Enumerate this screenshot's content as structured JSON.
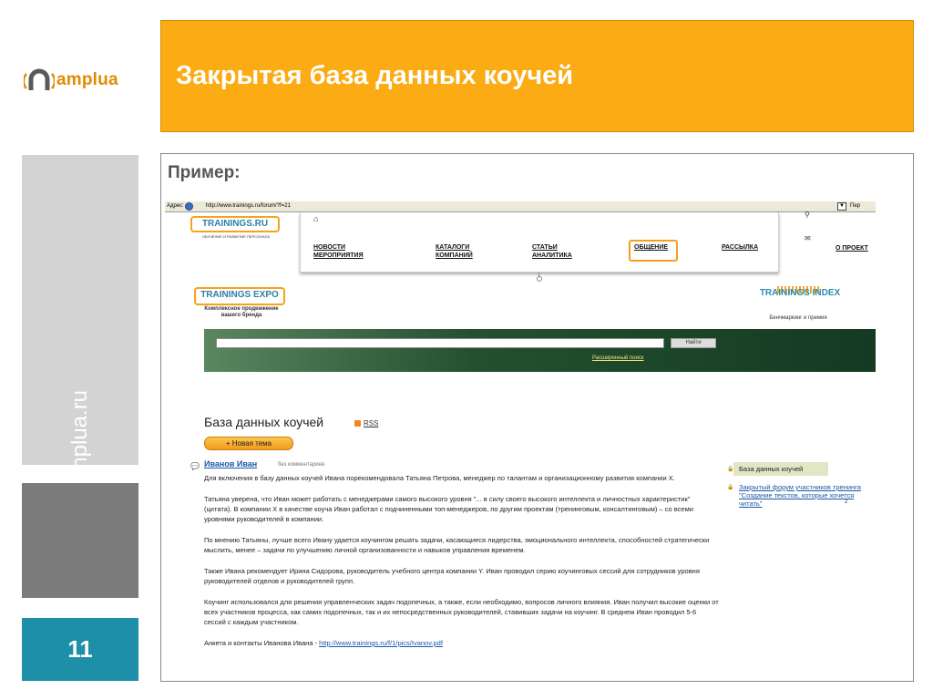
{
  "logo": {
    "text": "amplua"
  },
  "header": {
    "title": "Закрытая база данных коучей"
  },
  "sidebar": {
    "url_text": "www.amplua.ru",
    "page_number": "11"
  },
  "content": {
    "example_label": "Пример:"
  },
  "browser": {
    "address_label": "Адрес:",
    "address_url": "http://www.trainings.ru/forum/?f=21",
    "go_label": "Пер",
    "site_logo": "TRAININGS.RU",
    "site_logo_sub": "ОБУЧЕНИЕ И РАЗВИТИЕ ПЕРСОНАЛА",
    "nav": [
      {
        "line1": "НОВОСТИ",
        "line2": "МЕРОПРИЯТИЯ"
      },
      {
        "line1": "КАТАЛОГИ",
        "line2": "КОМПАНИЙ"
      },
      {
        "line1": "СТАТЬИ",
        "line2": "АНАЛИТИКА"
      },
      {
        "line1": "ОБЩЕНИЕ",
        "line2": ""
      },
      {
        "line1": "РАССЫЛКА",
        "line2": ""
      }
    ],
    "nav_extra": "О ПРОЕКТ",
    "expo_logo": "TRAININGS EXPO",
    "expo_sub_1": "Комплексное продвижение",
    "expo_sub_2": "вашего бренда",
    "index_logo": "TRAININGS INDEX",
    "index_sub": "Бенчмаркинг и премия",
    "search_button": "Найти",
    "advanced_search": "Расширенный поиск",
    "db_title": "База данных коучей",
    "rss": "RSS",
    "new_topic": "+ Новая тема",
    "post": {
      "author": "Иванов Иван",
      "meta": "без комментариев",
      "p1": "Для включения в базу данных коучей Ивана порекомендовала Татьяна Петрова, менеджер по талантам и организационному развития компании X.",
      "p2": "Татьяна уверена, что Иван может работать с менеджерами самого высокого уровня \"... в силу своего высокого интеллекта и личностных характеристик\" (цитата). В компании X в качестве коуча Иван работал с подчиненными топ-менеджеров, по другим проектам (тренинговым, консалтинговым) – со всеми уровнями руководителей в компании.",
      "p3": "По мнению Татьяны, лучше всего Ивану удается коучингом решать задачи, касающиеся лидерства, эмоционального интеллекта, способностей стратегически мыслить, менее – задачи по улучшению личной организованности и навыков управления временем.",
      "p4": "Также Ивана рекомендует Ирина Сидорова, руководитель учебного центра компании Y. Иван проводил серию коучинговых сессий для сотрудников уровня руководителей отделов и руководителей групп.",
      "p5": "Коучинг использовался для решения управленческих задач подопечных, а также, если необходимо, вопросов личного влияния. Иван получил высокие оценки от всех участников процесса, как самих подопечных, так и их непосредственных руководителей, ставивших задачи на коучинг. В среднем Иван проводил 5-6 сессий с каждым участником.",
      "p6_prefix": "Анкета и контакты Иванова Ивана - ",
      "p6_link": "http://www.trainings.ru/f/1/pics/Ivanov.pdf"
    },
    "side": {
      "item1": "База данных коучей",
      "item2": "Закрытый форум участников тренинга \"Создание текстов, которые хочется читать\"",
      "item2_count": "2"
    }
  }
}
